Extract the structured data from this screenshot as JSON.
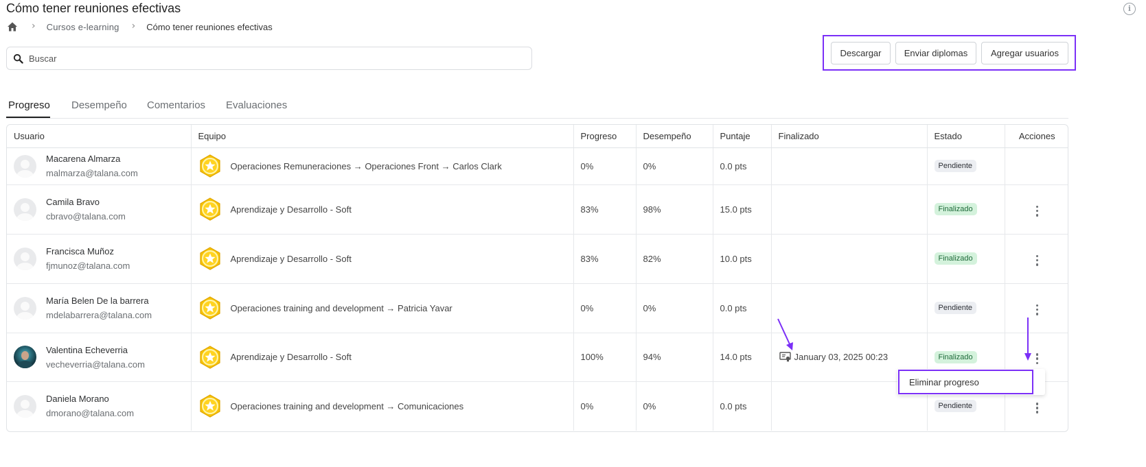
{
  "page": {
    "title": "Cómo tener reuniones efectivas",
    "info_icon": "info-icon"
  },
  "breadcrumb": {
    "home_icon": "home-icon",
    "items": [
      "Cursos e-learning",
      "Cómo tener reuniones efectivas"
    ]
  },
  "search": {
    "placeholder": "Buscar",
    "icon": "search-icon"
  },
  "toolbar": {
    "download_label": "Descargar",
    "send_diplomas_label": "Enviar diplomas",
    "add_users_label": "Agregar usuarios"
  },
  "tabs": [
    {
      "label": "Progreso",
      "active": true
    },
    {
      "label": "Desempeño",
      "active": false
    },
    {
      "label": "Comentarios",
      "active": false
    },
    {
      "label": "Evaluaciones",
      "active": false
    }
  ],
  "table": {
    "headers": [
      "Usuario",
      "Equipo",
      "Progreso",
      "Desempeño",
      "Puntaje",
      "Finalizado",
      "Estado",
      "Acciones"
    ],
    "rows": [
      {
        "name": "Macarena Almarza",
        "email": "malmarza@talana.com",
        "team": "Operaciones Remuneraciones → Operaciones Front → Carlos Clark",
        "progress": "0%",
        "performance": "0%",
        "score": "0.0 pts",
        "finished": "",
        "status": "Pendiente",
        "status_type": "pending",
        "has_actions": false,
        "avatar": "placeholder"
      },
      {
        "name": "Camila Bravo",
        "email": "cbravo@talana.com",
        "team": "Aprendizaje y Desarrollo - Soft",
        "progress": "83%",
        "performance": "98%",
        "score": "15.0 pts",
        "finished": "",
        "status": "Finalizado",
        "status_type": "done",
        "has_actions": true,
        "avatar": "placeholder"
      },
      {
        "name": "Francisca Muñoz",
        "email": "fjmunoz@talana.com",
        "team": "Aprendizaje y Desarrollo - Soft",
        "progress": "83%",
        "performance": "82%",
        "score": "10.0 pts",
        "finished": "",
        "status": "Finalizado",
        "status_type": "done",
        "has_actions": true,
        "avatar": "placeholder"
      },
      {
        "name": "María Belen De la barrera",
        "email": "mdelabarrera@talana.com",
        "team": "Operaciones training and development → Patricia Yavar",
        "progress": "0%",
        "performance": "0%",
        "score": "0.0 pts",
        "finished": "",
        "status": "Pendiente",
        "status_type": "pending",
        "has_actions": true,
        "avatar": "placeholder"
      },
      {
        "name": "Valentina Echeverria",
        "email": "vecheverria@talana.com",
        "team": "Aprendizaje y Desarrollo - Soft",
        "progress": "100%",
        "performance": "94%",
        "score": "14.0 pts",
        "finished": "January 03, 2025 00:23",
        "status": "Finalizado",
        "status_type": "done",
        "has_actions": true,
        "avatar": "photo"
      },
      {
        "name": "Daniela Morano",
        "email": "dmorano@talana.com",
        "team": "Operaciones training and development → Comunicaciones",
        "progress": "0%",
        "performance": "0%",
        "score": "0.0 pts",
        "finished": "",
        "status": "Pendiente",
        "status_type": "pending",
        "has_actions": true,
        "avatar": "placeholder"
      }
    ]
  },
  "dropdown": {
    "item_label": "Eliminar progreso"
  },
  "colors": {
    "highlight": "#7b2ff7",
    "badge_gold": "#f5b800",
    "status_done_bg": "#d4f2dc",
    "status_pending_bg": "#eceef2"
  }
}
